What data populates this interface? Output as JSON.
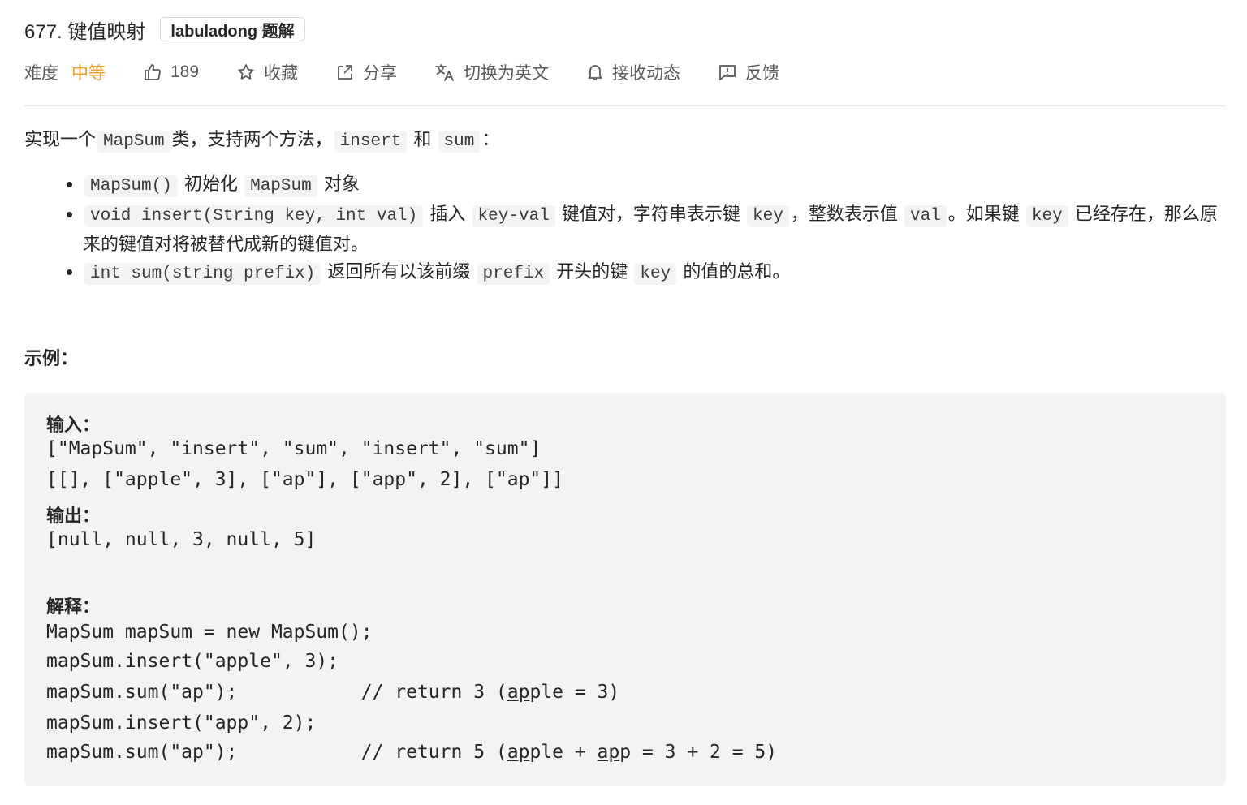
{
  "header": {
    "title": "677. 键值映射",
    "tag": "labuladong 题解"
  },
  "meta": {
    "difficulty_label": "难度",
    "difficulty_value": "中等",
    "likes": "189",
    "favorite": "收藏",
    "share": "分享",
    "translate": "切换为英文",
    "subscribe": "接收动态",
    "feedback": "反馈"
  },
  "desc": {
    "p1_a": "实现一个",
    "p1_code1": "MapSum",
    "p1_b": "类，支持两个方法，",
    "p1_code2": "insert",
    "p1_c": "和",
    "p1_code3": "sum",
    "p1_d": "："
  },
  "defs": {
    "d1_code": "MapSum()",
    "d1_a": "初始化",
    "d1_code2": "MapSum",
    "d1_b": "对象",
    "d2_code": "void insert(String key, int val)",
    "d2_a": "插入",
    "d2_code2": "key-val",
    "d2_b": "键值对，字符串表示键",
    "d2_code3": "key",
    "d2_c": "，整数表示值",
    "d2_code4": "val",
    "d2_d": "。如果键",
    "d2_code5": "key",
    "d2_e": "已经存在，那么原来的键值对将被替代成新的键值对。",
    "d3_code": "int sum(string prefix)",
    "d3_a": "返回所有以该前缀",
    "d3_code2": "prefix",
    "d3_b": "开头的键",
    "d3_code3": "key",
    "d3_c": "的值的总和。"
  },
  "example": {
    "heading": "示例：",
    "input_label": "输入：",
    "input_line1": "[\"MapSum\", \"insert\", \"sum\", \"insert\", \"sum\"]",
    "input_line2": "[[], [\"apple\", 3], [\"ap\"], [\"app\", 2], [\"ap\"]]",
    "output_label": "输出：",
    "output_line": "[null, null, 3, null, 5]",
    "explain_label": "解释：",
    "e1": "MapSum mapSum = new MapSum();",
    "e2": "mapSum.insert(\"apple\", 3);",
    "e3_pre": "mapSum.sum(\"ap\");           // return 3 (",
    "e3_u1": "ap",
    "e3_post": "ple = 3)",
    "e4": "mapSum.insert(\"app\", 2);",
    "e5_pre": "mapSum.sum(\"ap\");           // return 5 (",
    "e5_u1": "ap",
    "e5_mid": "ple + ",
    "e5_u2": "ap",
    "e5_post": "p = 3 + 2 = 5)"
  }
}
